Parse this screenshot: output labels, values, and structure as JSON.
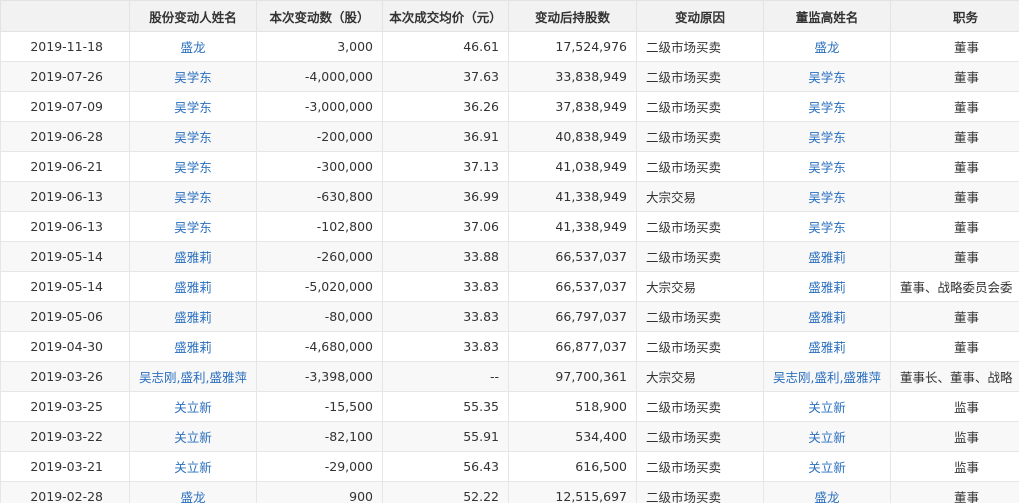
{
  "columns": [
    "",
    "股份变动人姓名",
    "本次变动数（股）",
    "本次成交均价（元）",
    "变动后持股数",
    "变动原因",
    "董监高姓名",
    "职务"
  ],
  "rows": [
    {
      "date": "2019-11-18",
      "person": "盛龙",
      "change": "3,000",
      "price": "46.61",
      "after": "17,524,976",
      "reason": "二级市场买卖",
      "exec": "盛龙",
      "position": "董事"
    },
    {
      "date": "2019-07-26",
      "person": "吴学东",
      "change": "-4,000,000",
      "price": "37.63",
      "after": "33,838,949",
      "reason": "二级市场买卖",
      "exec": "吴学东",
      "position": "董事"
    },
    {
      "date": "2019-07-09",
      "person": "吴学东",
      "change": "-3,000,000",
      "price": "36.26",
      "after": "37,838,949",
      "reason": "二级市场买卖",
      "exec": "吴学东",
      "position": "董事"
    },
    {
      "date": "2019-06-28",
      "person": "吴学东",
      "change": "-200,000",
      "price": "36.91",
      "after": "40,838,949",
      "reason": "二级市场买卖",
      "exec": "吴学东",
      "position": "董事"
    },
    {
      "date": "2019-06-21",
      "person": "吴学东",
      "change": "-300,000",
      "price": "37.13",
      "after": "41,038,949",
      "reason": "二级市场买卖",
      "exec": "吴学东",
      "position": "董事"
    },
    {
      "date": "2019-06-13",
      "person": "吴学东",
      "change": "-630,800",
      "price": "36.99",
      "after": "41,338,949",
      "reason": "大宗交易",
      "exec": "吴学东",
      "position": "董事"
    },
    {
      "date": "2019-06-13",
      "person": "吴学东",
      "change": "-102,800",
      "price": "37.06",
      "after": "41,338,949",
      "reason": "二级市场买卖",
      "exec": "吴学东",
      "position": "董事"
    },
    {
      "date": "2019-05-14",
      "person": "盛雅莉",
      "change": "-260,000",
      "price": "33.88",
      "after": "66,537,037",
      "reason": "二级市场买卖",
      "exec": "盛雅莉",
      "position": "董事"
    },
    {
      "date": "2019-05-14",
      "person": "盛雅莉",
      "change": "-5,020,000",
      "price": "33.83",
      "after": "66,537,037",
      "reason": "大宗交易",
      "exec": "盛雅莉",
      "position": "董事、战略委员会委"
    },
    {
      "date": "2019-05-06",
      "person": "盛雅莉",
      "change": "-80,000",
      "price": "33.83",
      "after": "66,797,037",
      "reason": "二级市场买卖",
      "exec": "盛雅莉",
      "position": "董事"
    },
    {
      "date": "2019-04-30",
      "person": "盛雅莉",
      "change": "-4,680,000",
      "price": "33.83",
      "after": "66,877,037",
      "reason": "二级市场买卖",
      "exec": "盛雅莉",
      "position": "董事"
    },
    {
      "date": "2019-03-26",
      "person": "吴志刚,盛利,盛雅萍",
      "change": "-3,398,000",
      "price": "--",
      "after": "97,700,361",
      "reason": "大宗交易",
      "exec": "吴志刚,盛利,盛雅萍",
      "position": "董事长、董事、战略"
    },
    {
      "date": "2019-03-25",
      "person": "关立新",
      "change": "-15,500",
      "price": "55.35",
      "after": "518,900",
      "reason": "二级市场买卖",
      "exec": "关立新",
      "position": "监事"
    },
    {
      "date": "2019-03-22",
      "person": "关立新",
      "change": "-82,100",
      "price": "55.91",
      "after": "534,400",
      "reason": "二级市场买卖",
      "exec": "关立新",
      "position": "监事"
    },
    {
      "date": "2019-03-21",
      "person": "关立新",
      "change": "-29,000",
      "price": "56.43",
      "after": "616,500",
      "reason": "二级市场买卖",
      "exec": "关立新",
      "position": "监事"
    },
    {
      "date": "2019-02-28",
      "person": "盛龙",
      "change": "900",
      "price": "52.22",
      "after": "12,515,697",
      "reason": "二级市场买卖",
      "exec": "盛龙",
      "position": "董事"
    }
  ]
}
